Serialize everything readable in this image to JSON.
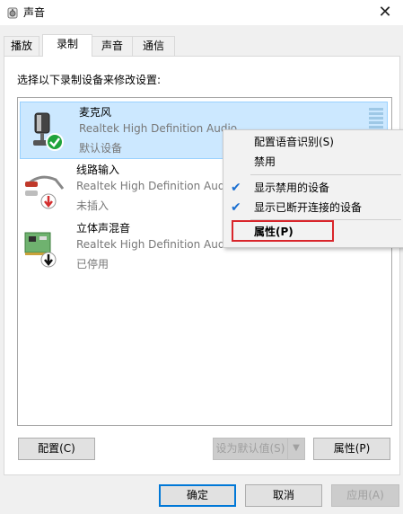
{
  "window": {
    "title": "声音",
    "close_glyph": "✕"
  },
  "tabs": [
    {
      "label": "播放",
      "active": false
    },
    {
      "label": "录制",
      "active": true
    },
    {
      "label": "声音",
      "active": false
    },
    {
      "label": "通信",
      "active": false
    }
  ],
  "prompt": "选择以下录制设备来修改设置:",
  "devices": [
    {
      "name": "麦克风",
      "driver": "Realtek High Definition Audio",
      "status": "默认设备",
      "icon": "microphone-icon",
      "badge": "green-check-badge",
      "selected": true
    },
    {
      "name": "线路输入",
      "driver": "Realtek High Definition Audio",
      "status": "未插入",
      "icon": "line-in-cable-icon",
      "badge": "red-down-arrow-badge",
      "selected": false
    },
    {
      "name": "立体声混音",
      "driver": "Realtek High Definition Audio",
      "status": "已停用",
      "icon": "sound-card-icon",
      "badge": "black-down-arrow-badge",
      "selected": false
    }
  ],
  "context_menu": {
    "items": [
      {
        "label": "配置语音识别(S)",
        "checked": false
      },
      {
        "label": "禁用",
        "checked": false
      },
      {
        "label": "显示禁用的设备",
        "checked": true
      },
      {
        "label": "显示已断开连接的设备",
        "checked": true
      },
      {
        "label": "属性(P)",
        "checked": false,
        "highlighted": true
      }
    ],
    "check_glyph": "✔",
    "highlight_color": "#d9262c"
  },
  "buttons": {
    "configure": "配置(C)",
    "set_default": "设为默认值(S)",
    "set_default_arrow": "▼",
    "properties": "属性(P)",
    "ok": "确定",
    "cancel": "取消",
    "apply": "应用(A)"
  },
  "colors": {
    "selection": "#cce8ff",
    "accent": "#0078d7"
  }
}
